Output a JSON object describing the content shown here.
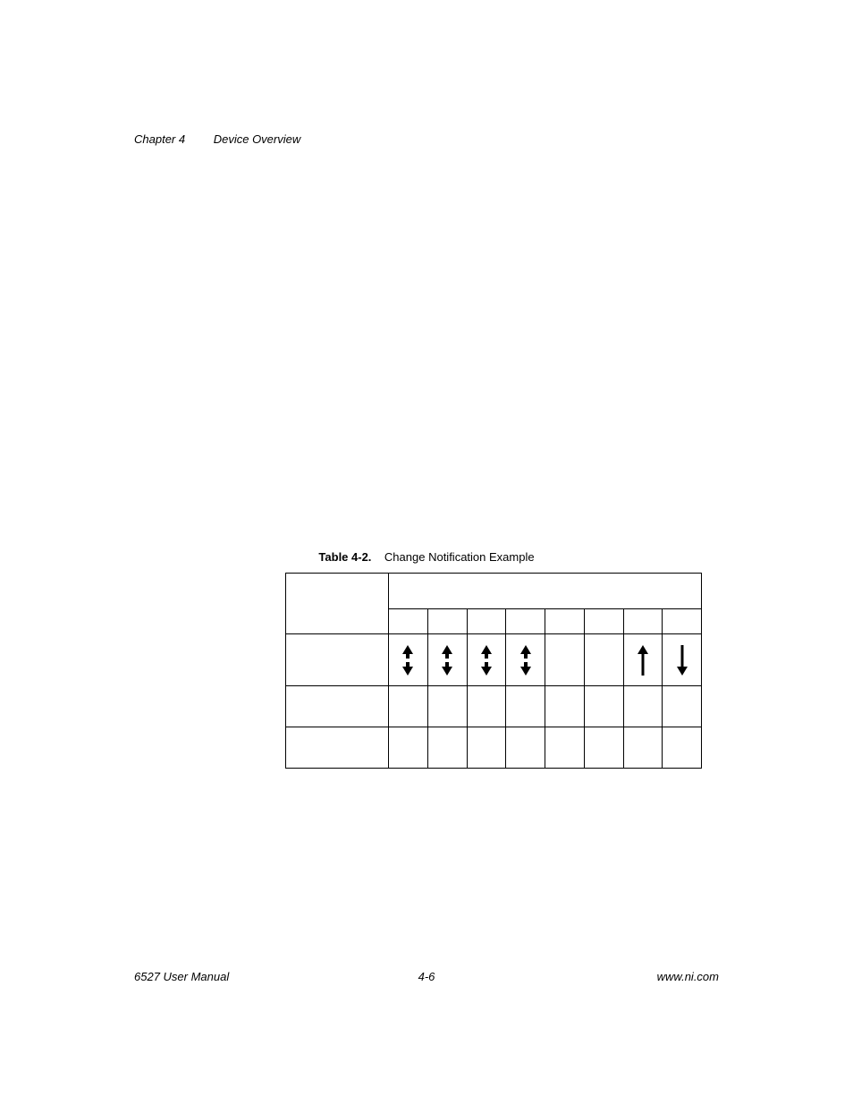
{
  "header": {
    "chapter": "Chapter 4",
    "title": "Device Overview"
  },
  "caption": {
    "label": "Table 4-2.",
    "text": "Change Notification Example"
  },
  "table": {
    "arrow_icons": [
      "updown",
      "updown",
      "updown",
      "updown",
      "",
      "",
      "up",
      "down"
    ]
  },
  "footer": {
    "left": "6527 User Manual",
    "center": "4-6",
    "right": "www.ni.com"
  }
}
